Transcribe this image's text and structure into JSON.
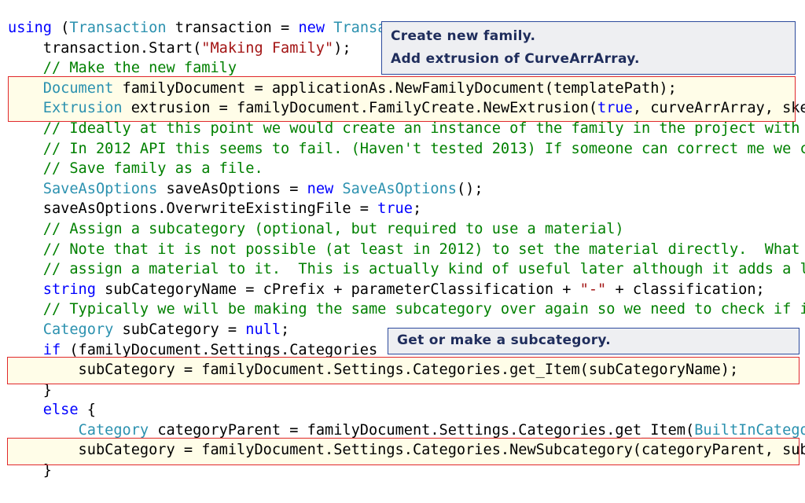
{
  "code_lines": [
    [
      [
        "kw",
        "using"
      ],
      [
        "tx",
        " ("
      ],
      [
        "ty",
        "Transaction"
      ],
      [
        "tx",
        " transaction = "
      ],
      [
        "kw",
        "new"
      ],
      [
        "tx",
        " "
      ],
      [
        "ty",
        "Transa"
      ]
    ],
    [
      [
        "tx",
        "    transaction.Start("
      ],
      [
        "st",
        "\"Making Family\""
      ],
      [
        "tx",
        ");"
      ]
    ],
    [
      [
        "cm",
        "    // Make the new family"
      ]
    ],
    [
      [
        "tx",
        "    "
      ],
      [
        "ty",
        "Document"
      ],
      [
        "tx",
        " familyDocument = applicationAs.NewFamilyDocument(templatePath);"
      ]
    ],
    [
      [
        "tx",
        "    "
      ],
      [
        "ty",
        "Extrusion"
      ],
      [
        "tx",
        " extrusion = familyDocument.FamilyCreate.NewExtrusion("
      ],
      [
        "kw",
        "true"
      ],
      [
        "tx",
        ", curveArrArray, ske"
      ]
    ],
    [
      [
        "cm",
        "    // Ideally at this point we would create an instance of the family in the project with"
      ]
    ],
    [
      [
        "cm",
        "    // In 2012 API this seems to fail. (Haven't tested 2013) If someone can correct me we c"
      ]
    ],
    [
      [
        "cm",
        "    // Save family as a file."
      ]
    ],
    [
      [
        "tx",
        "    "
      ],
      [
        "ty",
        "SaveAsOptions"
      ],
      [
        "tx",
        " saveAsOptions = "
      ],
      [
        "kw",
        "new"
      ],
      [
        "tx",
        " "
      ],
      [
        "ty",
        "SaveAsOptions"
      ],
      [
        "tx",
        "();"
      ]
    ],
    [
      [
        "tx",
        "    saveAsOptions.OverwriteExistingFile = "
      ],
      [
        "kw",
        "true"
      ],
      [
        "tx",
        ";"
      ]
    ],
    [
      [
        "cm",
        "    // Assign a subcategory (optional, but required to use a material)"
      ]
    ],
    [
      [
        "cm",
        "    // Note that it is not possible (at least in 2012) to set the material directly.  What"
      ]
    ],
    [
      [
        "cm",
        "    // assign a material to it.  This is actually kind of useful later although it adds a l"
      ]
    ],
    [
      [
        "tx",
        "    "
      ],
      [
        "kw",
        "string"
      ],
      [
        "tx",
        " subCategoryName = cPrefix + parameterClassification + "
      ],
      [
        "st",
        "\"-\""
      ],
      [
        "tx",
        " + classification;"
      ]
    ],
    [
      [
        "cm",
        "    // Typically we will be making the same subcategory over again so we need to check if i"
      ]
    ],
    [
      [
        "tx",
        "    "
      ],
      [
        "ty",
        "Category"
      ],
      [
        "tx",
        " subCategory = "
      ],
      [
        "kw",
        "null"
      ],
      [
        "tx",
        ";"
      ]
    ],
    [
      [
        "tx",
        "    "
      ],
      [
        "kw",
        "if"
      ],
      [
        "tx",
        " (familyDocument.Settings.Categories"
      ]
    ],
    [
      [
        "tx",
        "        subCategory = familyDocument.Settings.Categories.get_Item(subCategoryName);"
      ]
    ],
    [
      [
        "tx",
        "    }"
      ]
    ],
    [
      [
        "tx",
        "    "
      ],
      [
        "kw",
        "else"
      ],
      [
        "tx",
        " {"
      ]
    ],
    [
      [
        "tx",
        "        "
      ],
      [
        "ty",
        "Category"
      ],
      [
        "tx",
        " categoryParent = familyDocument.Settings.Categories.get_Item("
      ],
      [
        "ty",
        "BuiltInCatego"
      ]
    ],
    [
      [
        "tx",
        "        subCategory = familyDocument.Settings.Categories.NewSubcategory(categoryParent, sub"
      ]
    ],
    [
      [
        "tx",
        "    }"
      ]
    ]
  ],
  "annotations": {
    "create_family": {
      "line1": "Create new family.",
      "line2": "Add extrusion of CurveArrArray."
    },
    "subcategory": {
      "line1": "Get or make a subcategory."
    }
  },
  "colors": {
    "keyword": "#0000ff",
    "type": "#2b91af",
    "string": "#a31515",
    "comment": "#008000",
    "highlight_border": "#e0282c",
    "note_border": "#2c4a9c"
  }
}
